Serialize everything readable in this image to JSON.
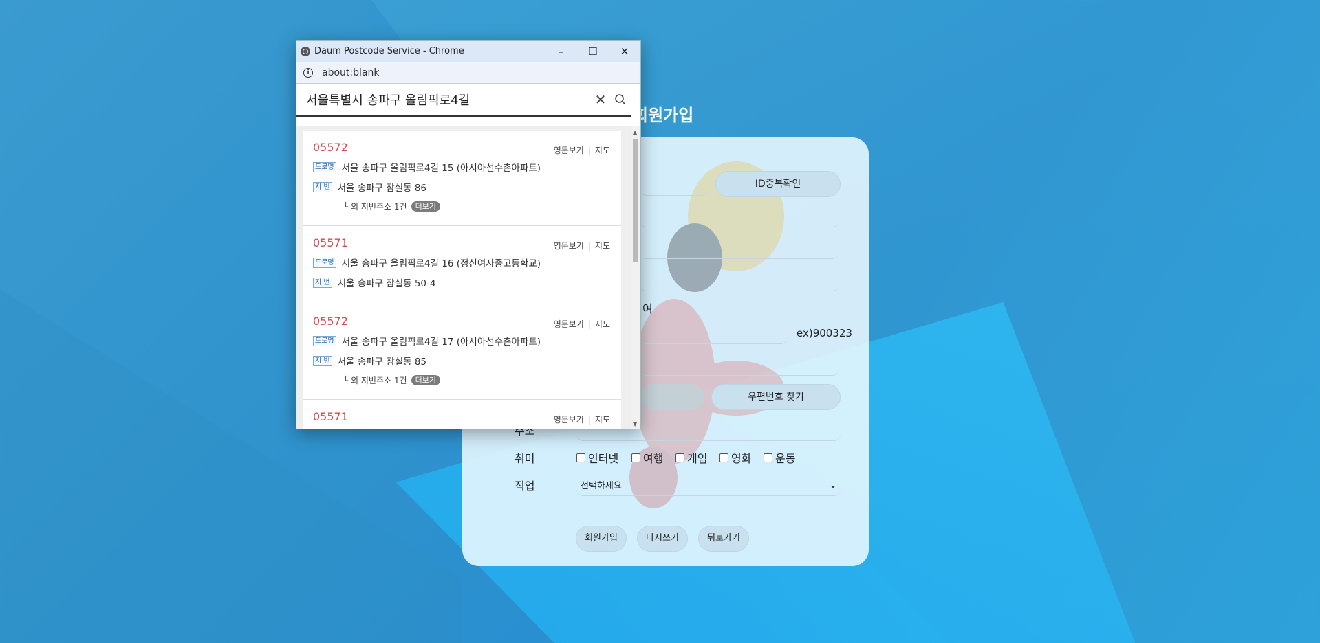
{
  "form": {
    "title": "회원가입",
    "id_check_button": "ID중복확인",
    "gender_female": "여",
    "birth_hint": "ex)900323",
    "postcode_button": "우편번호 찾기",
    "address_label": "주소",
    "hobby_label": "취미",
    "hobbies": [
      "인터넷",
      "여행",
      "게임",
      "영화",
      "운동"
    ],
    "job_label": "직업",
    "job_selected": "선택하세요",
    "submit_button": "회원가입",
    "reset_button": "다시쓰기",
    "back_button": "뒤로가기"
  },
  "popup": {
    "window_title": "Daum Postcode Service - Chrome",
    "url": "about:blank",
    "search_query": "서울특별시 송파구 올림픽로4길",
    "road_tag": "도로명",
    "jibun_tag": "지 번",
    "english_link": "영문보기",
    "map_link": "지도",
    "other_jibun_prefix": "└ 외 지번주소",
    "more_button": "더보기",
    "results": [
      {
        "zip": "05572",
        "road": "서울 송파구 올림픽로4길 15 (아시아선수촌아파트)",
        "jibun": "서울 송파구 잠실동 86",
        "other_count": "1건"
      },
      {
        "zip": "05571",
        "road": "서울 송파구 올림픽로4길 16 (정신여자중고등학교)",
        "jibun": "서울 송파구 잠실동 50-4",
        "other_count": ""
      },
      {
        "zip": "05572",
        "road": "서울 송파구 올림픽로4길 17 (아시아선수촌아파트)",
        "jibun": "서울 송파구 잠실동 85",
        "other_count": "1건"
      },
      {
        "zip": "05571",
        "road": "",
        "jibun": "",
        "other_count": ""
      }
    ]
  }
}
